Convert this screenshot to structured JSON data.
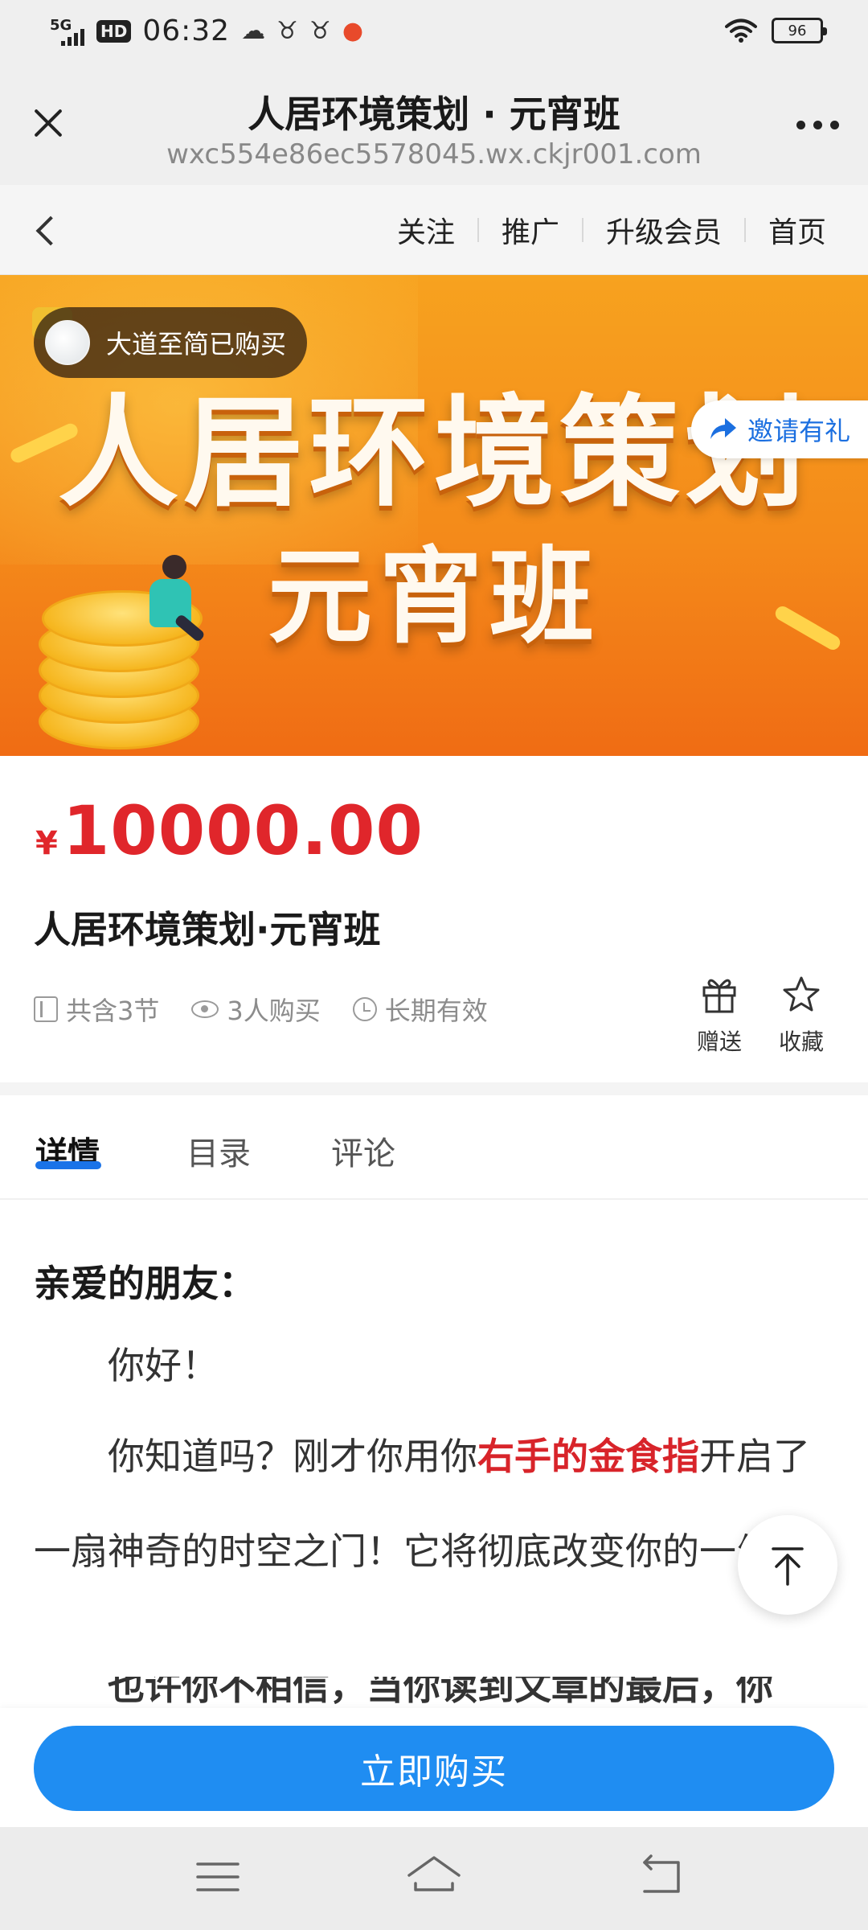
{
  "status_bar": {
    "network": "5G",
    "hd": "HD",
    "time": "06:32",
    "battery": "96"
  },
  "browser": {
    "title": "人居环境策划 · 元宵班",
    "url": "wxc554e86ec5578045.wx.ckjr001.com"
  },
  "subnav": {
    "links": [
      "关注",
      "推广",
      "升级会员",
      "首页"
    ]
  },
  "banner": {
    "title_line1": "人居环境策划",
    "title_line2": "元宵班",
    "buyer_notice": "大道至简已购买",
    "invite_label": "邀请有礼"
  },
  "product": {
    "currency": "¥",
    "price": "10000.00",
    "title": "人居环境策划·元宵班",
    "meta": {
      "sections": "共含3节",
      "purchases": "3人购买",
      "validity": "长期有效"
    },
    "actions": {
      "gift": "赠送",
      "favorite": "收藏"
    }
  },
  "tabs": [
    "详情",
    "目录",
    "评论"
  ],
  "active_tab": "详情",
  "article": {
    "greeting": "亲爱的朋友：",
    "p1": "你好！",
    "p2_before": "你知道吗？刚才你用你",
    "p2_highlight": "右手的金食指",
    "p2_after": "开启了一扇神奇的时空之门！它将彻底改变你的一生！",
    "p3_partial": "也许你不相信，当你读到文章的最后，你"
  },
  "buy_button": "立即购买",
  "colors": {
    "accent_blue": "#1f8df2",
    "price_red": "#e0262b",
    "banner_orange": "#f48a1a",
    "invite_blue": "#1b6fe0"
  },
  "icons": [
    "close-icon",
    "more-icon",
    "back-icon",
    "share-icon",
    "gift-icon",
    "star-icon",
    "book-icon",
    "eye-icon",
    "clock-icon",
    "arrow-up-icon",
    "menu-icon",
    "home-icon",
    "back-nav-icon"
  ]
}
